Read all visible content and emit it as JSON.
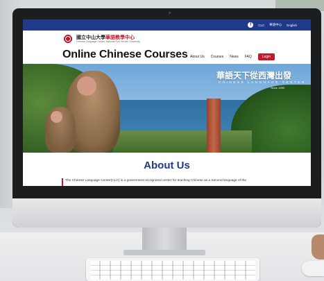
{
  "topbar": {
    "facebook_icon": "facebook-icon",
    "links": [
      "CLC",
      "華語中心",
      "English"
    ]
  },
  "header": {
    "school_name_zh_prefix": "國立中山大學",
    "school_name_zh_suffix": "華語教學中心",
    "school_name_en": "Chinese Language Center, National Sun Yat-sen University",
    "site_title": "Online Chinese Courses",
    "nav": [
      "About Us",
      "Courses",
      "News",
      "FAQ"
    ],
    "login_label": "Login"
  },
  "hero": {
    "headline_zh": "華語天下從西灣出發",
    "subtitle_en": "CHINESE LANGUAGE CENTER",
    "since": "Since 1990"
  },
  "content": {
    "section_title": "About Us",
    "intro_text": "The Chinese Language Center(CLC) is a government recognized center for teaching Chinese as a Second language of the"
  },
  "colors": {
    "brand_blue": "#1f3a8a",
    "brand_red": "#c0182c"
  }
}
